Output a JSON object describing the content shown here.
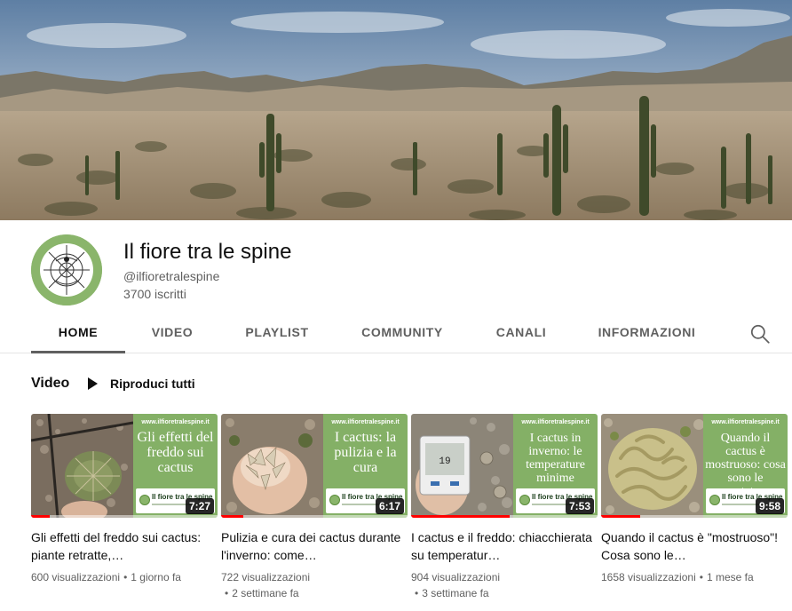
{
  "channel": {
    "name": "Il fiore tra le spine",
    "handle": "@ilfioretralespine",
    "subscribers": "3700 iscritti"
  },
  "tabs": [
    "HOME",
    "VIDEO",
    "PLAYLIST",
    "COMMUNITY",
    "CANALI",
    "INFORMAZIONI"
  ],
  "active_tab": "HOME",
  "section": {
    "title": "Video",
    "play_all_label": "Riproduci tutti"
  },
  "thumb_common": {
    "url": "www.ilfioretralespine.it",
    "brand": "Il fiore tra le spine"
  },
  "videos": [
    {
      "headline": "Gli effetti del freddo sui cactus",
      "duration": "7:27",
      "progress": 0.1,
      "title": "Gli effetti del freddo sui cactus: piante retratte,…",
      "views": "600 visualizzazioni",
      "age": "1 giorno fa"
    },
    {
      "headline": "I cactus: la pulizia e la cura",
      "duration": "6:17",
      "progress": 0.12,
      "title": "Pulizia e cura dei cactus durante l'inverno: come…",
      "views": "722 visualizzazioni",
      "age": "2 settimane fa"
    },
    {
      "headline": "I cactus in inverno: le temperature minime",
      "duration": "7:53",
      "progress": 0.53,
      "title": "I cactus e il freddo: chiacchierata su temperatur…",
      "views": "904 visualizzazioni",
      "age": "3 settimane fa"
    },
    {
      "headline": "Quando il cactus è mostruoso: cosa sono le crestature",
      "duration": "9:58",
      "progress": 0.21,
      "title": "Quando il cactus è \"mostruoso\"! Cosa sono le…",
      "views": "1658 visualizzazioni",
      "age": "1 mese fa"
    }
  ],
  "colors": {
    "thumb_panel": "#84b066",
    "progress": "#ff0000",
    "secondary_text": "#606060"
  }
}
